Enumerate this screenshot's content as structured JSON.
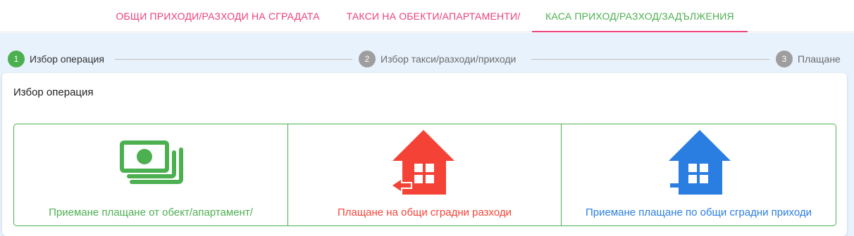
{
  "tabs": [
    {
      "label": "ОБЩИ ПРИХОДИ/РАЗХОДИ НА СГРАДАТА",
      "active": false
    },
    {
      "label": "ТАКСИ НА ОБЕКТИ/АПАРТАМЕНТИ/",
      "active": false
    },
    {
      "label": "КАСА ПРИХОД/РАЗХОД/ЗАДЪЛЖЕНИЯ",
      "active": true
    }
  ],
  "stepper": {
    "steps": [
      {
        "number": "1",
        "label": "Избор операция",
        "state": "active"
      },
      {
        "number": "2",
        "label": "Избор такси/разходи/приходи",
        "state": "inactive"
      },
      {
        "number": "3",
        "label": "Плащане",
        "state": "inactive"
      }
    ]
  },
  "panel": {
    "title": "Избор операция",
    "options": [
      {
        "label": "Приемане плащане от обект/апартамент/",
        "icon": "money-icon",
        "color": "#4caf50"
      },
      {
        "label": "Плащане на общи сградни разходи",
        "icon": "house-outgoing-icon",
        "color": "#f44336"
      },
      {
        "label": "Приемане плащане по общи сградни приходи",
        "icon": "house-incoming-icon",
        "color": "#2a7de1"
      }
    ]
  },
  "colors": {
    "accent_pink": "#ec407a",
    "success_green": "#4caf50",
    "danger_red": "#f44336",
    "info_blue": "#2a7de1"
  }
}
